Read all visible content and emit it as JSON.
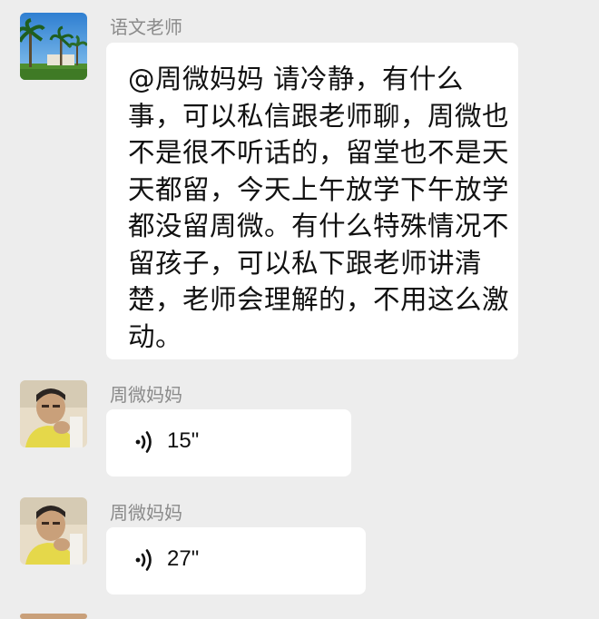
{
  "messages": [
    {
      "sender": "语文老师",
      "type": "text",
      "text": "@周微妈妈  请冷静，有什么事，可以私信跟老师聊，周微也不是很不听话的，留堂也不是天天都留，今天上午放学下午放学都没留周微。有什么特殊情况不留孩子，可以私下跟老师讲清楚，老师会理解的，不用这么激动。"
    },
    {
      "sender": "周微妈妈",
      "type": "voice",
      "duration": "15\""
    },
    {
      "sender": "周微妈妈",
      "type": "voice",
      "duration": "27\""
    }
  ]
}
